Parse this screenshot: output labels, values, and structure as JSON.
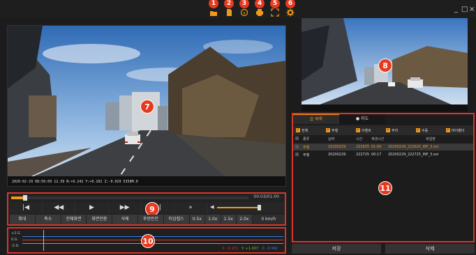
{
  "toolbar": {
    "badges": [
      "1",
      "2",
      "3",
      "4",
      "5",
      "6"
    ],
    "icons": [
      "folder-icon",
      "sd-card-icon",
      "info-icon",
      "print-icon",
      "capture-icon",
      "settings-icon"
    ],
    "minimize": "_",
    "maximize": "□",
    "close": "×"
  },
  "main_video": {
    "osd": "2020-02-29 08:56:09 12.39 N:+0.242 Y:+0.102 Z:-0.029 5358M.0",
    "callout": "7"
  },
  "rear_video": {
    "callout": "8"
  },
  "playback": {
    "timecode": "00:03/01:00",
    "progress_fraction": 0.05,
    "volume_fraction": 0.95,
    "controls": [
      {
        "name": "skip-start",
        "glyph": "|◀"
      },
      {
        "name": "rewind",
        "glyph": "◀◀"
      },
      {
        "name": "play",
        "glyph": "▶"
      },
      {
        "name": "fast-forward",
        "glyph": "▶▶"
      },
      {
        "name": "skip-end",
        "glyph": "▶|"
      },
      {
        "name": "speed-up",
        "glyph": "»"
      }
    ],
    "callout": "9",
    "buttons": [
      "확대",
      "축소",
      "전체화면",
      "화면전환",
      "삭제",
      "후방반전",
      "타임랩스",
      "0.5x",
      "1.0x",
      "1.5x",
      "2.0x",
      "0 km/h"
    ]
  },
  "gsensor": {
    "labels": [
      "+2.G",
      "0.G",
      "-2.G"
    ],
    "readout": {
      "x": "X: -0.171",
      "y": "Y: +1.007",
      "z": "Z: -0.992"
    },
    "colors": {
      "x": "#d9362a",
      "y": "#6abf3a",
      "z": "#3a7ad9"
    },
    "callout": "10"
  },
  "list": {
    "tabs": [
      "목록",
      "지도"
    ],
    "filters": [
      "전체",
      "주행",
      "이벤트",
      "주차",
      "수동",
      "마이폴더"
    ],
    "headers": [
      "종류",
      "날짜",
      "시간",
      "재생시간",
      "파일명"
    ],
    "rows": [
      {
        "type": "주행",
        "date": "20200229",
        "time": "222625",
        "duration": "01:00",
        "file": "20200229_222625_INF_3.avi"
      },
      {
        "type": "주행",
        "date": "20200229",
        "time": "222725",
        "duration": "00:17",
        "file": "20200229_222725_INF_3.avi"
      }
    ],
    "callout": "11"
  },
  "actions": {
    "save": "저장",
    "delete": "삭제"
  },
  "colors": {
    "accent": "#f09a1a",
    "callout": "#e8391e",
    "highlight": "#d9362a"
  }
}
